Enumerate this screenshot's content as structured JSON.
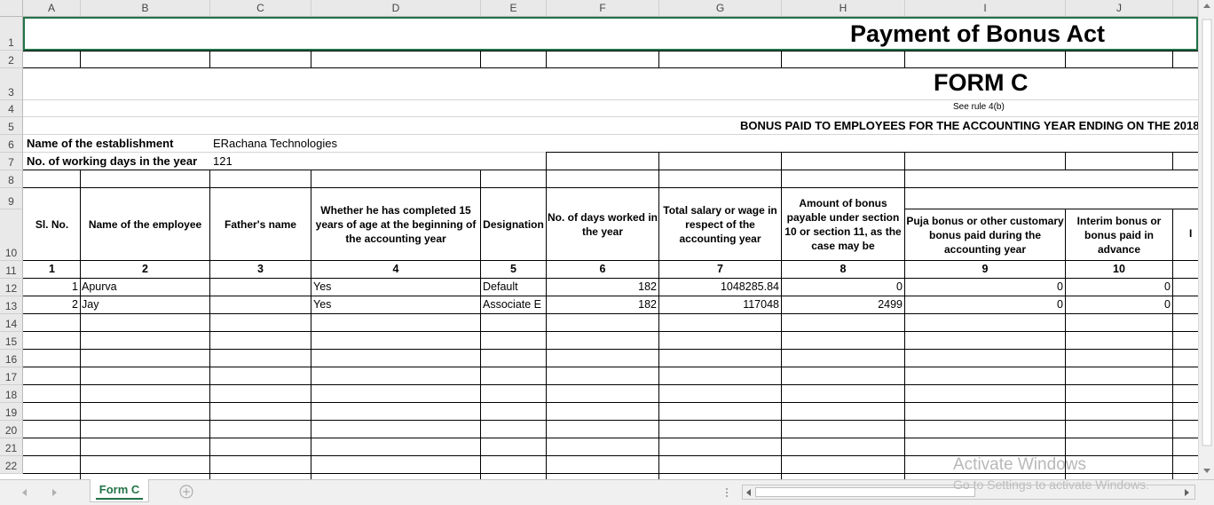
{
  "columns": [
    "A",
    "B",
    "C",
    "D",
    "E",
    "F",
    "G",
    "H",
    "I",
    "J"
  ],
  "rows": [
    "1",
    "2",
    "3",
    "4",
    "5",
    "6",
    "7",
    "8",
    "9",
    "10",
    "11",
    "12",
    "13",
    "14",
    "15",
    "16",
    "17",
    "18",
    "19",
    "20",
    "21",
    "22"
  ],
  "title": "Payment of Bonus Act",
  "form_title": "FORM C",
  "rule": "See rule 4(b)",
  "subtitle": "BONUS PAID TO EMPLOYEES FOR THE ACCOUNTING YEAR ENDING ON THE 2018",
  "establishment_label": "Name of the establishment",
  "establishment_value": "ERachana Technologies",
  "working_days_label": "No. of working days in the year",
  "working_days_value": "121",
  "headers": [
    "Sl. No.",
    "Name of the employee",
    "Father's name",
    "Whether he has completed 15 years of age at the beginning of the accounting year",
    "Designation",
    "No. of days worked in the year",
    "Total salary or wage in respect of the accounting year",
    "Amount of bonus payable under section 10 or section 11, as the case may be",
    "Puja bonus or other customary bonus paid during the accounting year",
    "Interim bonus or bonus paid in advance"
  ],
  "header_numbers": [
    "1",
    "2",
    "3",
    "4",
    "5",
    "6",
    "7",
    "8",
    "9",
    "10"
  ],
  "data_rows": [
    {
      "sl": "1",
      "name": "Apurva",
      "father": "",
      "age15": "Yes",
      "designation": "Default",
      "days": "182",
      "salary": "1048285.84",
      "bonus": "0",
      "puja": "0",
      "interim": "0"
    },
    {
      "sl": "2",
      "name": "Jay",
      "father": "",
      "age15": "Yes",
      "designation": "Associate E",
      "days": "182",
      "salary": "117048",
      "bonus": "2499",
      "puja": "0",
      "interim": "0"
    }
  ],
  "k_partial": "I",
  "sheet_tab": "Form C",
  "watermark_line1": "Activate Windows",
  "watermark_line2": "Go to Settings to activate Windows.",
  "colors": {
    "accent": "#217346",
    "header_bg": "#e9e9e9",
    "gridline": "#d4d4d4"
  }
}
